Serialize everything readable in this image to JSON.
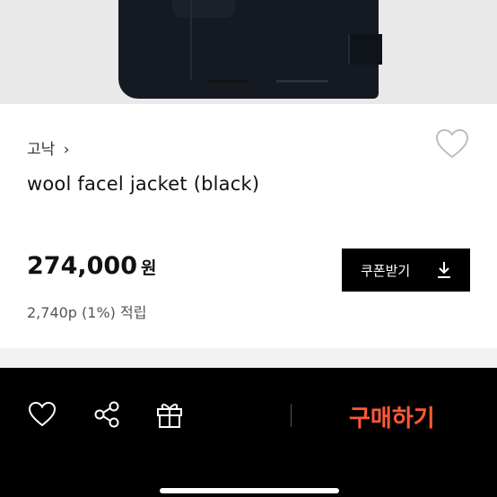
{
  "product": {
    "brand": "고낙",
    "brand_chevron": "›",
    "title": "wool facel jacket (black)",
    "price": "274,000",
    "currency": "원",
    "points": "2,740p (1%) 적립"
  },
  "coupon_button": {
    "label": "쿠폰받기",
    "icon": "download-icon"
  },
  "bottom_bar": {
    "wishlist_icon": "heart-outline-icon",
    "share_icon": "share-icon",
    "gift_icon": "gift-icon",
    "buy_label": "구매하기"
  },
  "carousel": {
    "active_index": 0,
    "count": 2
  },
  "colors": {
    "accent": "#ff5a36",
    "bar_bg": "#000000"
  }
}
